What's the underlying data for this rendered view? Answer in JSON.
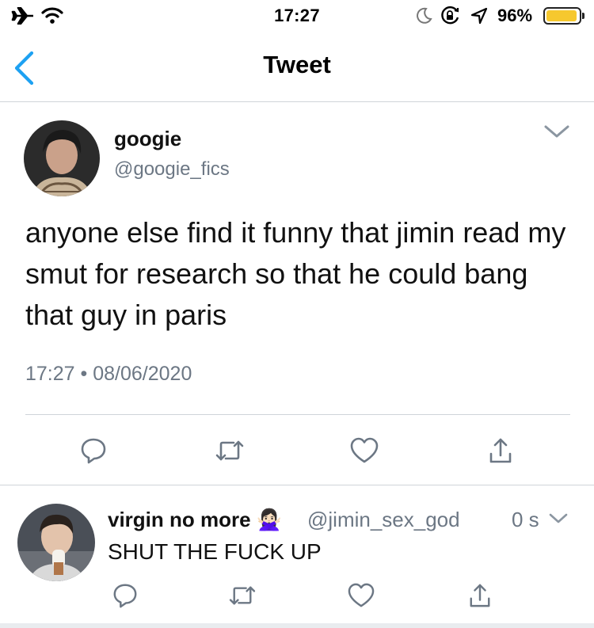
{
  "status_bar": {
    "time": "17:27",
    "battery_percent": "96%",
    "battery_level": 0.96,
    "icons": [
      "airplane-icon",
      "wifi-icon",
      "moon-icon",
      "rotation-lock-icon",
      "location-icon",
      "battery-icon"
    ]
  },
  "nav": {
    "title": "Tweet",
    "back_icon": "chevron-left-icon"
  },
  "tweet": {
    "name": "googie",
    "handle": "@googie_fics",
    "text": "anyone else find it funny that jimin read my smut for research so that he could bang that guy in paris",
    "time": "17:27",
    "separator": "•",
    "date": "08/06/2020"
  },
  "actions": [
    "reply-icon",
    "retweet-icon",
    "like-icon",
    "share-icon"
  ],
  "reply": {
    "name": "virgin no more",
    "emoji": "🙅🏻‍♀️",
    "handle": "@jimin_sex_god",
    "time": "0 s",
    "text": "SHUT THE FUCK UP"
  },
  "colors": {
    "accent": "#1da1f2",
    "secondary_text": "#6c7784",
    "icon_gray": "#6c7784",
    "divider": "#cfd4d9",
    "battery_fill": "#f6c82e"
  }
}
